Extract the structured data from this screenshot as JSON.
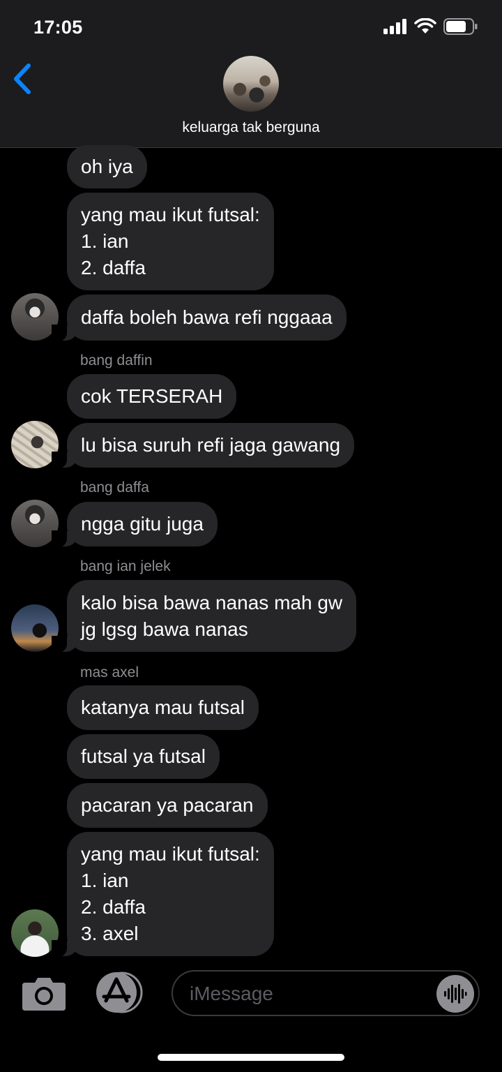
{
  "status": {
    "time": "17:05"
  },
  "header": {
    "group_name": "keluarga tak berguna"
  },
  "messages": [
    {
      "text": "oh iya"
    },
    {
      "text": "yang mau ikut futsal:\n1. ian\n2. daffa"
    },
    {
      "text": "daffa boleh bawa refi nggaaa"
    },
    {
      "sender": "bang daffin",
      "text": "cok TERSERAH"
    },
    {
      "text": "lu bisa suruh refi jaga gawang"
    },
    {
      "sender": "bang daffa",
      "text": "ngga gitu juga"
    },
    {
      "sender": "bang ian jelek",
      "text": "kalo bisa bawa nanas mah gw\njg lgsg bawa nanas"
    },
    {
      "sender": "mas axel",
      "text": "katanya mau futsal"
    },
    {
      "text": "futsal ya futsal"
    },
    {
      "text": "pacaran ya pacaran"
    },
    {
      "text": "yang mau ikut futsal:\n1. ian\n2. daffa\n3. axel"
    }
  ],
  "composer": {
    "placeholder": "iMessage"
  }
}
